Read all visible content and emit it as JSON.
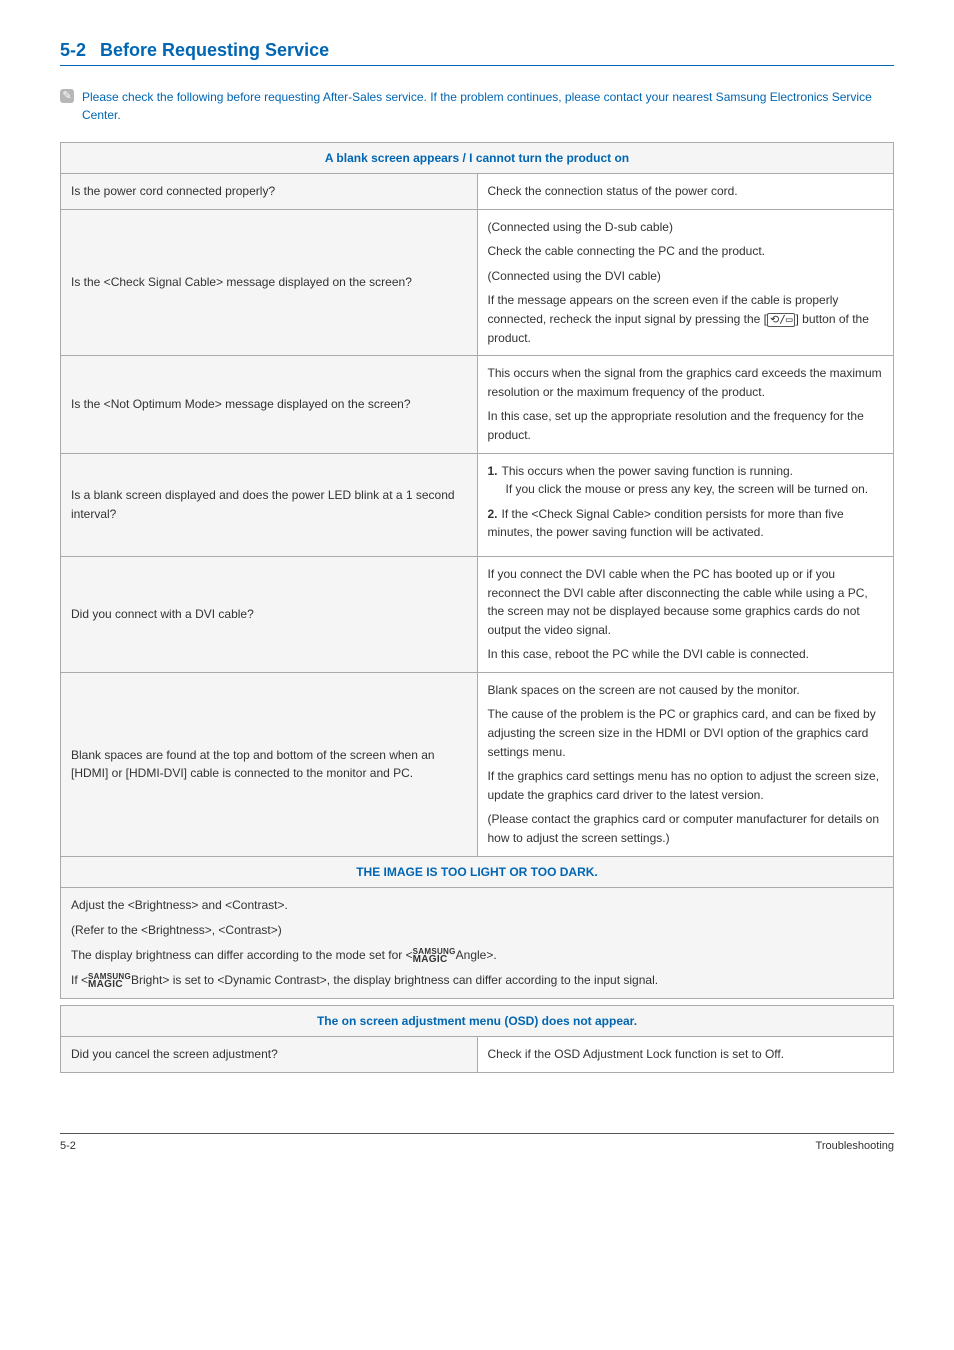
{
  "heading": {
    "num": "5-2",
    "title": "Before Requesting Service"
  },
  "note": "Please check the following before requesting After-Sales service. If the problem continues, please contact your nearest Samsung Electronics Service Center.",
  "table1": {
    "header": "A blank screen appears / I cannot turn the product on",
    "rows": [
      {
        "l": "Is the power cord connected properly?",
        "r_plain": "Check the connection status of the power cord."
      },
      {
        "l": "Is the <Check Signal Cable> message displayed on the screen?",
        "r_paras": [
          "(Connected using the D-sub cable)",
          "Check the cable connecting the PC and the product.",
          "(Connected using the DVI cable)"
        ],
        "r_last_pre": "If the message appears on the screen even if the cable is properly connected, recheck the input signal by pressing the [",
        "r_last_post": "] button of the product."
      },
      {
        "l": "Is the <Not Optimum Mode> message displayed on the screen?",
        "r_paras": [
          "This occurs when the signal from the graphics card exceeds the maximum resolution or the maximum frequency of the product.",
          "In this case, set up the appropriate resolution and the frequency for the product."
        ]
      },
      {
        "l": "Is a blank screen displayed and does the power LED blink at a 1 second interval?",
        "r_list": [
          {
            "first": "This occurs when the power saving function is running.",
            "cont": "If you click the mouse or press any key, the screen will be turned on."
          },
          {
            "first": "If the <Check Signal Cable> condition persists for more than five minutes, the power saving function will be activated."
          }
        ]
      },
      {
        "l": "Did you connect with a DVI cable?",
        "r_paras": [
          "If you connect the DVI cable when the PC has booted up or if you reconnect the DVI cable after disconnecting the cable while using a PC, the screen may not be displayed because some graphics cards do not output the video signal.",
          "In this case, reboot the PC while the DVI cable is connected."
        ]
      },
      {
        "l": "Blank spaces are found at the top and bottom of the screen when an [HDMI] or [HDMI-DVI] cable is connected to the monitor and PC.",
        "r_paras": [
          "Blank spaces on the screen are not caused by the monitor.",
          "The cause of the problem is the PC or graphics card, and can be fixed by adjusting the screen size in the HDMI or DVI option of the graphics card settings menu.",
          "If the graphics card settings menu has no option to adjust the screen size, update the graphics card driver to the latest version.",
          "(Please contact the graphics card or computer manufacturer for details on how to adjust the screen settings.)"
        ]
      }
    ],
    "header2": "THE IMAGE IS TOO LIGHT OR TOO DARK.",
    "band": {
      "p1": "Adjust the <Brightness> and <Contrast>.",
      "p2": "(Refer to the <Brightness>, <Contrast>)",
      "p3_pre": "The display brightness can differ according to the mode set for <",
      "p3_post": "Angle>.",
      "p4_pre": "If <",
      "p4_post": "Bright> is set to <Dynamic Contrast>, the display brightness can differ according to the input signal."
    }
  },
  "table2": {
    "header": "The on screen adjustment menu (OSD) does not appear.",
    "row": {
      "l": "Did you cancel the screen adjustment?",
      "r": "Check if the OSD Adjustment Lock function is set to Off."
    }
  },
  "footer": {
    "left": "5-2",
    "right": "Troubleshooting"
  },
  "icons": {
    "note_glyph": "⃠",
    "source_glyph": "⟲/▭"
  },
  "chart_data": null
}
